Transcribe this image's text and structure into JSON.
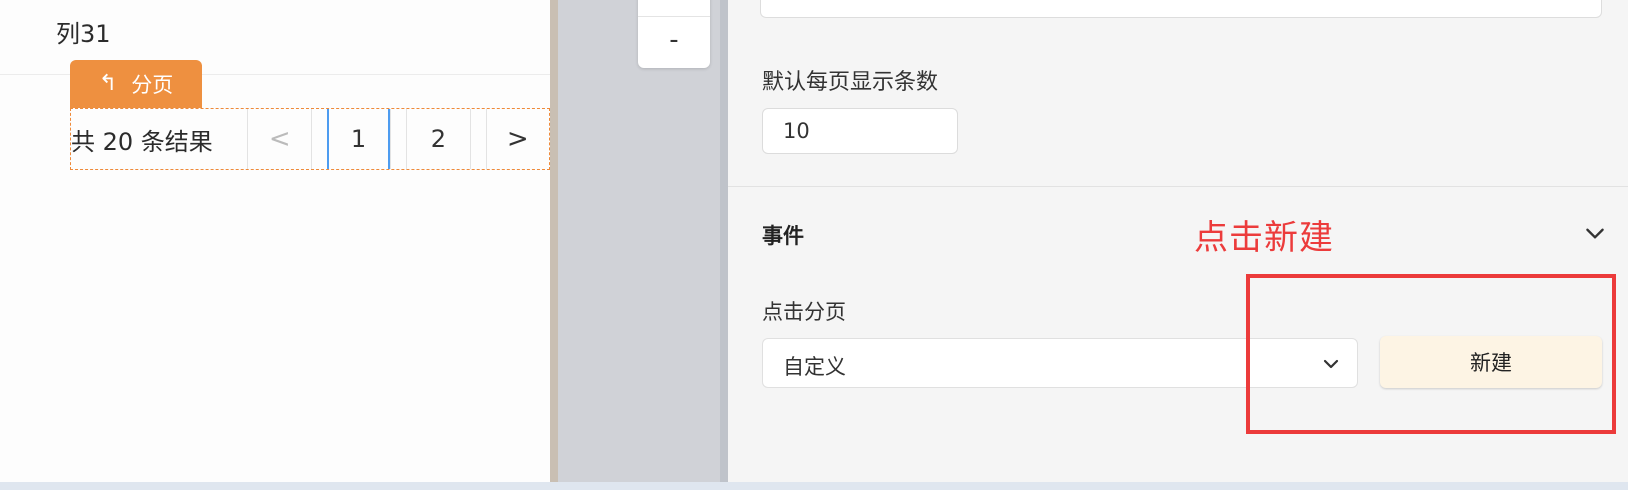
{
  "canvas": {
    "column_header": "列31",
    "component_tag": {
      "icon": "return-up-icon",
      "icon_glyph": "↰",
      "label": "分页"
    },
    "pagination": {
      "total_text": "共 20 条结果",
      "prev_glyph": "<",
      "pages": [
        "1",
        "2"
      ],
      "active_page": "1",
      "next_glyph": ">"
    }
  },
  "middle": {
    "zoom_minus": "-"
  },
  "panel": {
    "page_size_label": "默认每页显示条数",
    "page_size_value": "10",
    "events_section_title": "事件",
    "click_page_label": "点击分页",
    "click_page_select_value": "自定义",
    "new_button_label": "新建"
  },
  "annotation": {
    "text": "点击新建",
    "color": "#ec3b3b"
  },
  "colors": {
    "tag_orange": "#ee9040",
    "active_page_blue": "#4d9cf0",
    "new_button_bg": "#fdf4e4"
  }
}
